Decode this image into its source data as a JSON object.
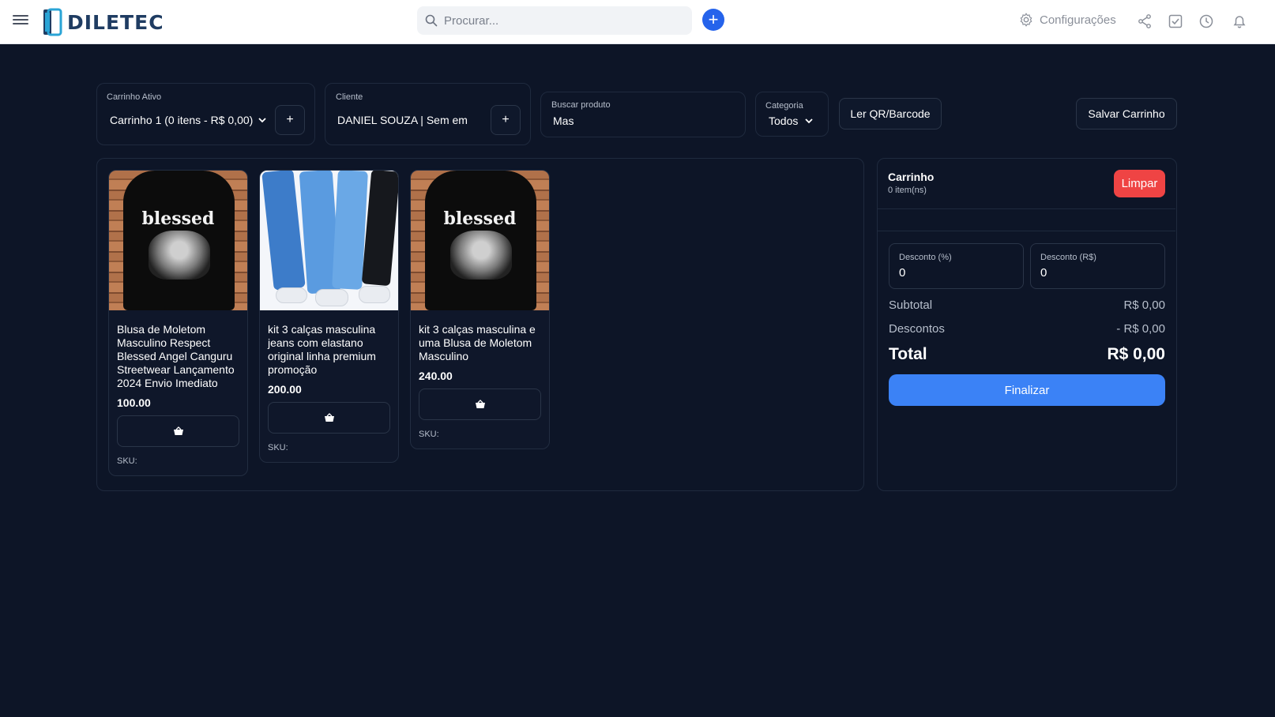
{
  "app": {
    "brand": "DILETEC"
  },
  "topbar": {
    "search_placeholder": "Procurar...",
    "settings_label": "Configurações",
    "icons": [
      "menu-icon",
      "search-icon",
      "add-icon",
      "gear-icon",
      "share-icon",
      "check-square-icon",
      "clock-icon",
      "bell-icon"
    ]
  },
  "filters": {
    "active_cart_label": "Carrinho Ativo",
    "active_cart_value": "Carrinho 1 (0 itens - R$ 0,00)",
    "client_label": "Cliente",
    "client_value": "DANIEL SOUZA | Sem email",
    "product_search_label": "Buscar produto",
    "product_search_value": "Mas",
    "category_label": "Categoria",
    "category_value": "Todos",
    "add_symbol": "+",
    "qr_button": "Ler QR/Barcode",
    "save_button": "Salvar Carrinho"
  },
  "products": [
    {
      "name": "Blusa de Moletom Masculino Respect Blessed Angel Canguru Streetwear Lançamento 2024 Envio Imediato",
      "price": "100.00",
      "sku_label": "SKU:",
      "image": "blessed-hoodie",
      "image_text": "blessed"
    },
    {
      "name": "kit 3 calças masculina jeans com elastano original linha premium promoção",
      "price": "200.00",
      "sku_label": "SKU:",
      "image": "jeans"
    },
    {
      "name": "kit 3 calças masculina e uma Blusa de Moletom Masculino",
      "price": "240.00",
      "sku_label": "SKU:",
      "image": "blessed-hoodie",
      "image_text": "blessed"
    }
  ],
  "cart": {
    "title": "Carrinho",
    "count": "0 item(ns)",
    "clear_button": "Limpar",
    "discount_pct_label": "Desconto (%)",
    "discount_pct_value": "0",
    "discount_rs_label": "Desconto (R$)",
    "discount_rs_value": "0",
    "subtotal_label": "Subtotal",
    "subtotal_value": "R$ 0,00",
    "discounts_label": "Descontos",
    "discounts_value": "- R$ 0,00",
    "total_label": "Total",
    "total_value": "R$ 0,00",
    "finish_button": "Finalizar"
  },
  "colors": {
    "background": "#0d1527",
    "primary": "#3b82f6",
    "danger": "#ef4444",
    "add_button": "#2563eb"
  }
}
